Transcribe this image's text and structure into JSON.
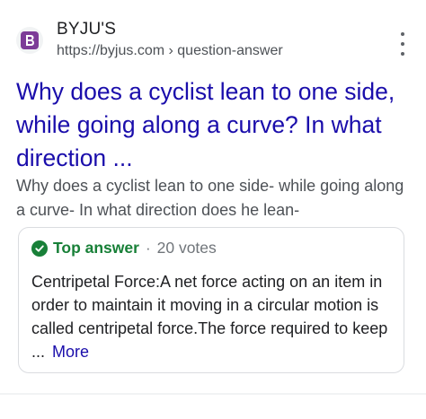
{
  "source": {
    "site_name": "BYJU'S",
    "favicon_letter": "B",
    "url": "https://byjus.com",
    "breadcrumb_separator": "›",
    "breadcrumb": "question-answer",
    "menu_icon": "more-vert-icon"
  },
  "result": {
    "title": "Why does a cyclist lean to one side, while going along a curve? In what direction ...",
    "snippet": "Why does a cyclist lean to one side- while going along a curve- In what direction does he lean-"
  },
  "answer": {
    "badge_label": "Top answer",
    "separator": "·",
    "votes": "20 votes",
    "body": "Centripetal Force:A net force acting on an item in order to maintain it moving in a circular motion is called centripetal force.The force required to keep",
    "ellipsis": "...",
    "more_label": "More"
  },
  "colors": {
    "title_link": "#1a0dab",
    "badge_green": "#188038",
    "favicon_purple": "#7d3c98",
    "card_border": "#dadce0"
  }
}
